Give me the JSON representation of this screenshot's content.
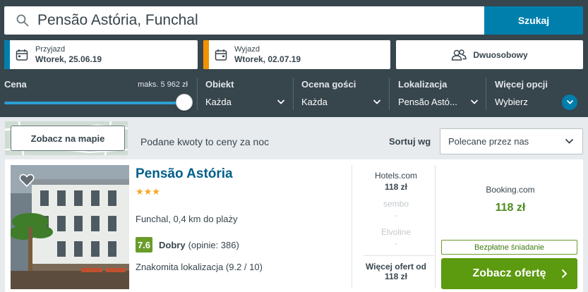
{
  "search": {
    "query": "Pensão Astória, Funchal",
    "button": "Szukaj"
  },
  "checkin": {
    "label": "Przyjazd",
    "value": "Wtorek, 25.06.19",
    "accent": "#007fad"
  },
  "checkout": {
    "label": "Wyjazd",
    "value": "Wtorek, 02.07.19",
    "accent": "#f29200"
  },
  "room": {
    "label": "Dwuosobowy"
  },
  "filters": {
    "price": {
      "label": "Cena",
      "max": "maks. 5 962 zł",
      "slider_fraction": 1.0
    },
    "property": {
      "label": "Obiekt",
      "value": "Każda"
    },
    "rating": {
      "label": "Ocena gości",
      "value": "Każda"
    },
    "location": {
      "label": "Lokalizacja",
      "value": "Pensão Astó..."
    },
    "more": {
      "label": "Więcej opcji",
      "value": "Wybierz"
    }
  },
  "results": {
    "map_button": "Zobacz na mapie",
    "price_note": "Podane kwoty to ceny za noc",
    "sort_label": "Sortuj wg",
    "sort_value": "Polecane przez nas"
  },
  "hotel": {
    "name": "Pensão Astória",
    "stars": "★★★",
    "location": "Funchal, 0,4 km do plaży",
    "rating_score": "7.6",
    "rating_text": "Dobry",
    "rating_count": "(opinie: 386)",
    "highlight": "Znakomita lokalizacja (9.2 / 10)",
    "offers": [
      {
        "provider": "Hotels.com",
        "price": "118 zł",
        "available": true
      },
      {
        "provider": "sembo",
        "price": "-",
        "available": false
      },
      {
        "provider": "Elvoline",
        "price": "-",
        "available": false
      }
    ],
    "more_offers_line1": "Więcej ofert od",
    "more_offers_line2": "118 zł",
    "best": {
      "provider": "Booking.com",
      "price": "118 zł",
      "breakfast": "Bezpłatne śniadanie",
      "cta": "Zobacz ofertę"
    }
  },
  "colors": {
    "header_bg": "#37454d",
    "accent_blue": "#007fad",
    "deal_green": "#5c9a0f",
    "rating_green": "#6a9c2a",
    "star_orange": "#f5a623"
  }
}
